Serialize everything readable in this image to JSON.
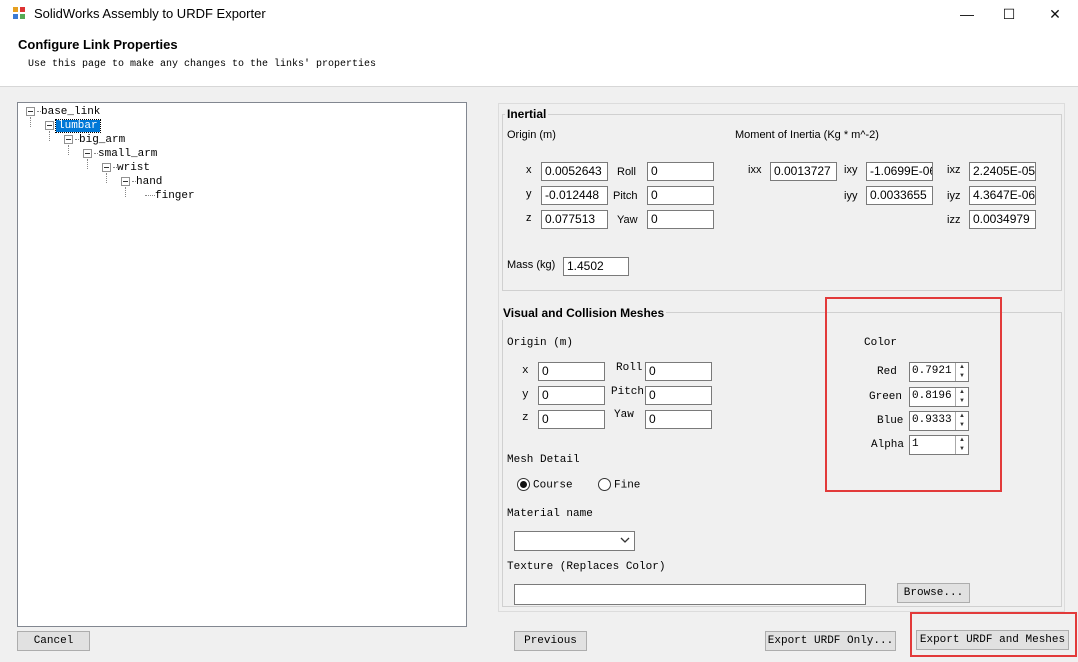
{
  "window": {
    "title": "SolidWorks Assembly to URDF Exporter",
    "minimize": "—",
    "maximize": "☐",
    "close": "✕"
  },
  "header": {
    "title": "Configure Link Properties",
    "subtitle": "Use this page to make any changes to the links' properties"
  },
  "tree": {
    "nodes": [
      "base_link",
      "lumbar",
      "big_arm",
      "small_arm",
      "wrist",
      "hand",
      "finger"
    ],
    "selected": "lumbar"
  },
  "inertial": {
    "title": "Inertial",
    "origin_label": "Origin (m)",
    "moi_label": "Moment of Inertia (Kg * m^-2)",
    "x_label": "x",
    "y_label": "y",
    "z_label": "z",
    "roll_label": "Roll",
    "pitch_label": "Pitch",
    "yaw_label": "Yaw",
    "x": "0.0052643",
    "y": "-0.012448",
    "z": "0.077513",
    "roll": "0",
    "pitch": "0",
    "yaw": "0",
    "ixx_label": "ixx",
    "ixy_label": "ixy",
    "ixz_label": "ixz",
    "iyy_label": "iyy",
    "iyz_label": "iyz",
    "izz_label": "izz",
    "ixx": "0.0013727",
    "ixy": "-1.0699E-06",
    "ixz": "2.2405E-05",
    "iyy": "0.0033655",
    "iyz": "4.3647E-06",
    "izz": "0.0034979",
    "mass_label": "Mass (kg)",
    "mass": "1.4502"
  },
  "visual": {
    "title": "Visual and Collision Meshes",
    "origin_label": "Origin (m)",
    "x_label": "x",
    "y_label": "y",
    "z_label": "z",
    "roll_label": "Roll",
    "pitch_label": "Pitch",
    "yaw_label": "Yaw",
    "x": "0",
    "y": "0",
    "z": "0",
    "roll": "0",
    "pitch": "0",
    "yaw": "0",
    "color_label": "Color",
    "red_label": "Red",
    "green_label": "Green",
    "blue_label": "Blue",
    "alpha_label": "Alpha",
    "red": "0.79216",
    "green": "0.81961",
    "blue": "0.93333",
    "alpha": "1",
    "mesh_detail_label": "Mesh Detail",
    "course_label": "Course",
    "fine_label": "Fine",
    "material_label": "Material name",
    "material_value": "",
    "texture_label": "Texture (Replaces Color)",
    "texture_value": "",
    "browse_label": "Browse..."
  },
  "buttons": {
    "cancel": "Cancel",
    "previous": "Previous",
    "export_urdf": "Export URDF Only...",
    "export_meshes": "Export URDF  and Meshes"
  },
  "colors": {
    "highlight": "#e23a3a",
    "selection": "#0078d7"
  }
}
